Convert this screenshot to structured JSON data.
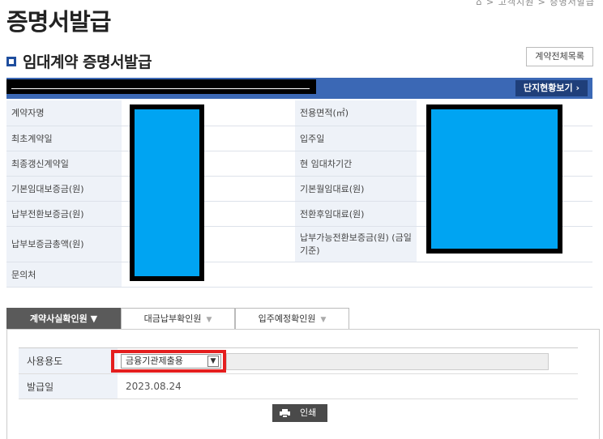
{
  "breadcrumb": "⌂ > 고객지원 > 증명서발급",
  "page_title": "증명서발급",
  "section_title": "임대계약 증명서발급",
  "buttons": {
    "contract_list": "계약전체목록",
    "complex_status": "단지현황보기 ›",
    "print": "인쇄"
  },
  "info_table": {
    "rows": [
      {
        "l1": "계약자명",
        "l2": "전용면적(㎡)"
      },
      {
        "l1": "최초계약일",
        "l2": "입주일"
      },
      {
        "l1": "최종갱신계약일",
        "l2": "현 임대차기간"
      },
      {
        "l1": "기본임대보증금(원)",
        "l2": "기본월임대료(원)"
      },
      {
        "l1": "납부전환보증금(원)",
        "l2": "전환후임대료(원)"
      },
      {
        "l1": "납부보증금총액(원)",
        "l2": "납부가능전환보증금(원) (금일기준)"
      },
      {
        "l1": "문의처",
        "l2": ""
      }
    ]
  },
  "tabs": [
    {
      "label": "계약사실확인원 ▼",
      "active": true
    },
    {
      "label": "대금납부확인원",
      "active": false
    },
    {
      "label": "입주예정확인원",
      "active": false
    }
  ],
  "form": {
    "usage_label": "사용용도",
    "usage_selected": "금융기관제출용",
    "issue_date_label": "발급일",
    "issue_date": "2023.08.24"
  },
  "colors": {
    "accent_blue": "#3b68b5",
    "mask_blue": "#00a4f2",
    "highlight_red": "#e41e1e"
  }
}
